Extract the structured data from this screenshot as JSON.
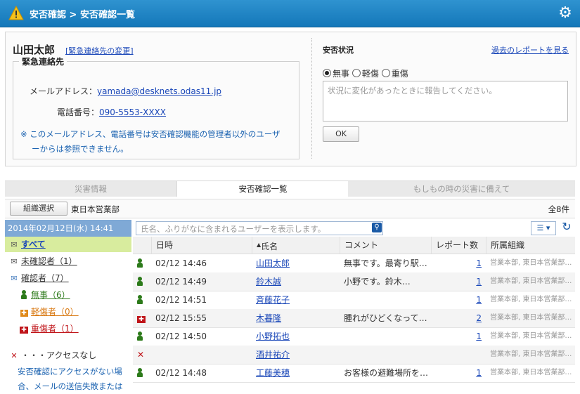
{
  "header": {
    "title": "安否確認 > 安否確認一覧"
  },
  "profile": {
    "name": "山田太郎",
    "change_link": "[緊急連絡先の変更]",
    "contact_legend": "緊急連絡先",
    "email_label": "メールアドレス：",
    "email_value": "yamada@desknets.odas11.jp",
    "phone_label": "電話番号：",
    "phone_value": "090-5553-XXXX",
    "note_line1": "※ このメールアドレス、電話番号は安否確認機能の管理者以外のユーザ",
    "note_line2": "ーからは参照できません。"
  },
  "status": {
    "title": "安否状況",
    "past_link": "過去のレポートを見る",
    "options": [
      "無事",
      "軽傷",
      "重傷"
    ],
    "selected": "無事",
    "placeholder": "状況に変化があったときに報告してください。",
    "ok_label": "OK"
  },
  "tabs": [
    "災害情報",
    "安否確認一覧",
    "もしもの時の災害に備えて"
  ],
  "active_tab": "安否確認一覧",
  "org": {
    "button": "組織選択",
    "name": "東日本営業部",
    "count": "全8件"
  },
  "sidebar": {
    "date": "2014年02月12日(水) 14:41",
    "items": [
      {
        "label": "すべて"
      },
      {
        "label": "未確認者（1）"
      },
      {
        "label": "確認者（7）"
      },
      {
        "label": "無事（6）"
      },
      {
        "label": "軽傷者（0）"
      },
      {
        "label": "重傷者（1）"
      }
    ],
    "no_access_label": "・・・アクセスなし",
    "note_line1": "安否確認にアクセスがない場",
    "note_line2": "合、メールの送信失敗または"
  },
  "search": {
    "placeholder": "氏名、ふりがなに含まれるユーザーを表示します。"
  },
  "table": {
    "headers": [
      "日時",
      "氏名",
      "コメント",
      "レポート数",
      "所属組織"
    ],
    "rows": [
      {
        "status": "safe",
        "date": "02/12 14:46",
        "name": "山田太郎",
        "comment": "無事です。最寄り駅…",
        "reports": "1",
        "org": "営業本部, 東日本営業部…"
      },
      {
        "status": "safe",
        "date": "02/12 14:49",
        "name": "鈴木誠",
        "comment": "小野です。鈴木…",
        "reports": "1",
        "org": "営業本部, 東日本営業部…"
      },
      {
        "status": "safe",
        "date": "02/12 14:51",
        "name": "斉藤花子",
        "comment": "",
        "reports": "1",
        "org": "営業本部, 東日本営業部…"
      },
      {
        "status": "severe",
        "date": "02/12 15:55",
        "name": "木暮隆",
        "comment": "腫れがひどくなって…",
        "reports": "2",
        "org": "営業本部, 東日本営業部…"
      },
      {
        "status": "safe",
        "date": "02/12 14:50",
        "name": "小野拓也",
        "comment": "",
        "reports": "1",
        "org": "営業本部, 東日本営業部…"
      },
      {
        "status": "noaccess",
        "date": "",
        "name": "酒井祐介",
        "comment": "",
        "reports": "",
        "org": "営業本部, 東日本営業部…"
      },
      {
        "status": "safe",
        "date": "02/12 14:48",
        "name": "工藤美穂",
        "comment": "お客様の避難場所を…",
        "reports": "1",
        "org": "営業本部, 東日本営業部…"
      }
    ]
  }
}
